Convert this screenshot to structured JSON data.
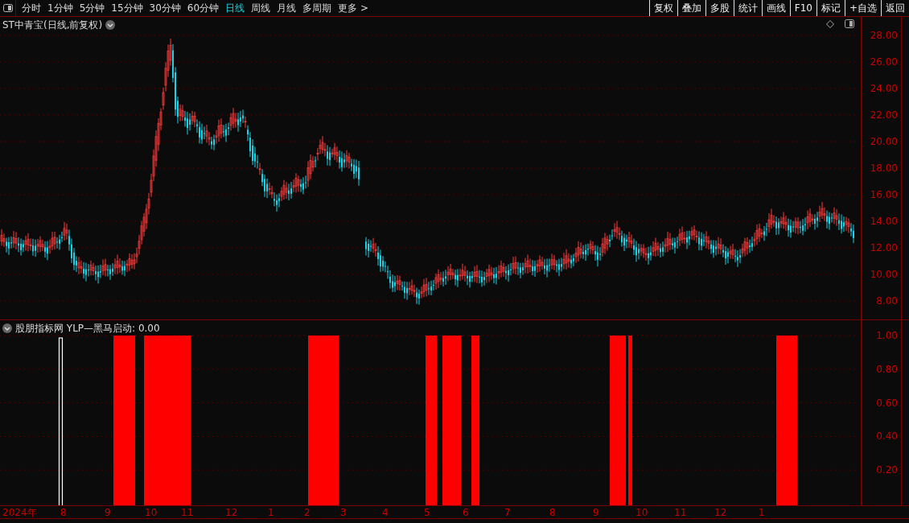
{
  "toolbar": {
    "periods": [
      {
        "label": "分时",
        "selected": false
      },
      {
        "label": "1分钟",
        "selected": false
      },
      {
        "label": "5分钟",
        "selected": false
      },
      {
        "label": "15分钟",
        "selected": false
      },
      {
        "label": "30分钟",
        "selected": false
      },
      {
        "label": "60分钟",
        "selected": false
      },
      {
        "label": "日线",
        "selected": true
      },
      {
        "label": "周线",
        "selected": false
      },
      {
        "label": "月线",
        "selected": false
      },
      {
        "label": "多周期",
        "selected": false
      },
      {
        "label": "更多 >",
        "selected": false
      }
    ],
    "buttons": [
      "复权",
      "叠加",
      "多股",
      "统计",
      "画线",
      "F10",
      "标记",
      "+自选",
      "返回"
    ]
  },
  "price_chart": {
    "title": "ST中青宝(日线,前复权)",
    "y_axis": [
      "28.00",
      "26.00",
      "24.00",
      "22.00",
      "20.00",
      "18.00",
      "16.00",
      "14.00",
      "12.00",
      "10.00",
      "8.00"
    ]
  },
  "indicator": {
    "title": "股朋指标网 YLP—黑马启动: 0.00",
    "y_axis": [
      "1.00",
      "0.80",
      "0.60",
      "0.40",
      "0.20"
    ]
  },
  "x_axis": [
    "2024年",
    "8",
    "9",
    "10",
    "11",
    "12",
    "1",
    "2",
    "3",
    "4",
    "5",
    "6",
    "7",
    "8",
    "9",
    "10",
    "11",
    "12",
    "1"
  ]
}
